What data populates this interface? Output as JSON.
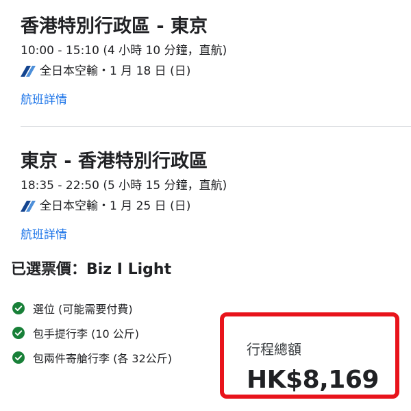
{
  "outbound": {
    "route": "香港特別行政區 - 東京",
    "time": "10:00 - 15:10 (4 小時 10 分鐘，直航)",
    "airline_date": "全日本空輸・1 月 18 日 (日)",
    "details_label": "航班詳情"
  },
  "inbound": {
    "route": "東京 - 香港特別行政區",
    "time": "18:35 - 22:50 (5 小時 15 分鐘，直航)",
    "airline_date": "全日本空輸・1 月 25 日 (日)",
    "details_label": "航班詳情"
  },
  "fare": {
    "title": "已選票價：Biz I Light",
    "features": [
      "選位 (可能需要付費)",
      "包手提行李 (10 公斤)",
      "包兩件寄艙行李 (各 32公斤)"
    ]
  },
  "total": {
    "label": "行程總額",
    "price": "HK$8,169"
  },
  "colors": {
    "link": "#1a73e8",
    "check": "#188038",
    "highlight_border": "#e8141b",
    "ana_dark": "#13448f",
    "ana_light": "#4d8fd9"
  },
  "icons": {
    "airline_logo": "ana-logo-icon",
    "feature_check": "check-circle-icon"
  }
}
